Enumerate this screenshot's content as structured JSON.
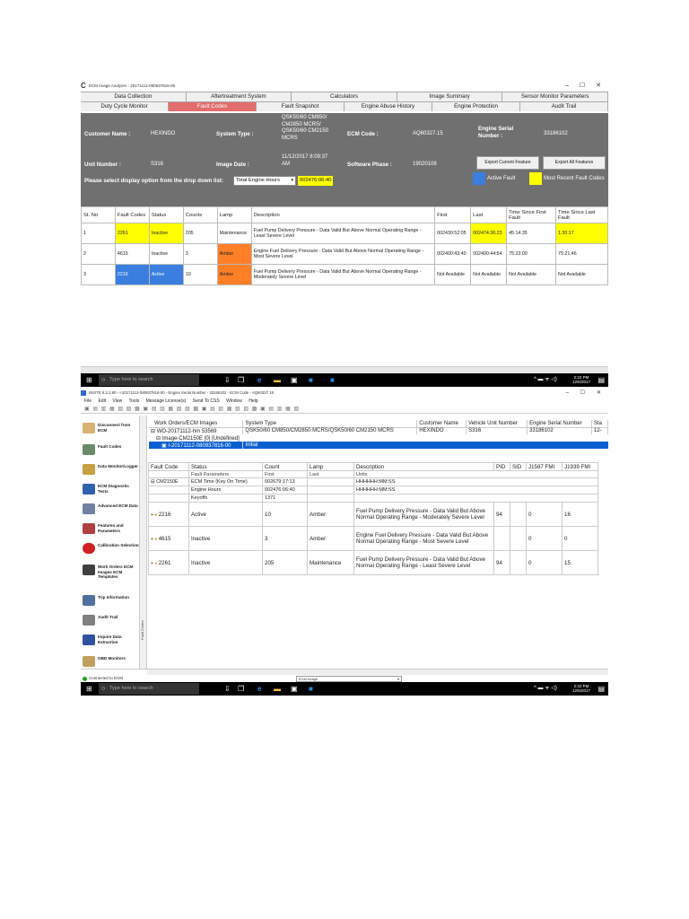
{
  "win1": {
    "title": "ECM Image Analyzer - 20171112-080937816-00",
    "tabs_row1": [
      "Data Collection",
      "Aftertreatment System",
      "Calculators",
      "Image Summary",
      "Sensor Monitor Parameters"
    ],
    "tabs_row2": [
      "Duty Cycle Monitor",
      "Fault Codes",
      "Fault Snapshot",
      "Engine Abuse History",
      "Engine Protection",
      "Audit Trail"
    ],
    "customer_name_label": "Customer Name :",
    "customer_name": "HEXINDO",
    "system_type_label": "System Type :",
    "system_type": "QSK50/60 CM850/ CM2850 MCRS/ QSK50/60 CM2150 MCRS",
    "ecm_code_label": "ECM Code :",
    "ecm_code": "AQ60327.15",
    "engine_serial_label": "Engine Serial Number :",
    "engine_serial": "33186102",
    "unit_number_label": "Unit Number :",
    "unit_number": "S316",
    "image_date_label": "Image Date :",
    "image_date": "11/12/2017 8:09:37 AM",
    "software_phase_label": "Software Phase :",
    "software_phase": "19020108",
    "export_current": "Export Current Feature",
    "export_all": "Export All Features",
    "display_option_label": "Please select display option from the drop down list:",
    "display_option_value": "Total Engine Hours",
    "display_hours": "002476:06:40",
    "legend_active": "Active Fault",
    "legend_recent": "Most Recent Fault Codes",
    "colors": {
      "active": "#3a7fe0",
      "recent": "#ffff00",
      "amber": "#ff7f27",
      "info_bg": "#707070"
    },
    "headers": [
      "St. No",
      "Fault Codes",
      "Status",
      "Counts",
      "Lamp",
      "Description",
      "First",
      "Last",
      "Time Since First Fault",
      "Time Since Last Fault"
    ],
    "rows": [
      [
        "1",
        "2261",
        "Inactive",
        "205",
        "Maintenance",
        "Fuel Pump Delivery Pressure - Data Valid But Above Normal Operating Range - Least Severe Level",
        "002430:52:05",
        "002474:36:23",
        "45:14:35",
        "1:30:17"
      ],
      [
        "2",
        "4615",
        "Inactive",
        "3",
        "Amber",
        "Engine Fuel Delivery Pressure - Data Valid But Above Normal Operating Range - Most Severe Level",
        "002400:43:40",
        "002400:44:54",
        "75:23:00",
        "75:21:46"
      ],
      [
        "3",
        "2216",
        "Active",
        "10",
        "Amber",
        "Fuel Pump Delivery Pressure - Data Valid But Above Normal Operating Range - Moderately Severe Level",
        "Not Available",
        "Not Available",
        "Not Available",
        "Not Available"
      ]
    ]
  },
  "taskbar1": {
    "search": "Type here to search",
    "time": "2:22 PM",
    "date": "12/5/2017"
  },
  "win2": {
    "title": "INSITE 8.2.2.80 - I-20171112-080937816-00 - Engine Serial Number - 33186102 - ECM Code - AQ60327.15",
    "menu": [
      "File",
      "Edit",
      "View",
      "Tools",
      "Message License(s)",
      "Send To CSS",
      "Window",
      "Help"
    ],
    "sidebar": [
      "Disconnect from ECM",
      "Fault Codes",
      "Data Monitor/Logger",
      "ECM Diagnostic Tests",
      "Advanced ECM Data",
      "Features and Parameters",
      "Calibration Selection",
      "Work Orders ECM Images ECM Templates",
      "Trip Information",
      "Audit Trail",
      "Inquire Data Extraction",
      "OBD Monitors"
    ],
    "top_headers": [
      "Work Orders/ECM Images",
      "System Type",
      "Customer Name",
      "Vehicle Unit Number",
      "Engine Serial Number",
      "Sta"
    ],
    "wo_row": [
      "WO-20171112-hm 53569",
      "QSK50/60 CM850/CM2850 MCRS/QSK50/60 CM2150 MCRS",
      "HEXINDO",
      "S316",
      "33186102",
      "12-"
    ],
    "image_row": "Image-CM2150E [0] [Undefined]",
    "selected_row": "I-20171112-080937816-00",
    "selected_status": "Initial",
    "g2_headers": [
      "Fault Code",
      "Status",
      "Count",
      "Lamp",
      "Description",
      "PID",
      "SID",
      "J1587 FMI",
      "J1939 FMI"
    ],
    "g2_sub": [
      "",
      "Fault Parameters",
      "First",
      "Last",
      "Units"
    ],
    "ecm_group": "CM2150E",
    "params": [
      [
        "ECM Time (Key On Time)",
        "002679:17:13",
        "",
        "HHHHHH:MM:SS"
      ],
      [
        "Engine Hours",
        "002476:06:40",
        "",
        "HHHHHH:MM:SS"
      ],
      [
        "Keyoffs",
        "1371",
        "",
        ""
      ]
    ],
    "faults": [
      [
        "2216",
        "Active",
        "10",
        "Amber",
        "Fuel Pump Delivery Pressure - Data Valid But Above Normal Operating Range - Moderately Severe Level",
        "94",
        "",
        "0",
        "16"
      ],
      [
        "4615",
        "Inactive",
        "3",
        "Amber",
        "Engine Fuel Delivery Pressure - Data Valid But Above Normal Operating Range - Most Severe Level",
        "",
        "",
        "0",
        "0"
      ],
      [
        "2261",
        "Inactive",
        "205",
        "Maintenance",
        "Fuel Pump Delivery Pressure - Data Valid But Above Normal Operating Range - Least Severe Level",
        "94",
        "",
        "0",
        "15"
      ]
    ],
    "status_connected": "Connected to ECM",
    "status_dropdown": "ECM Image",
    "vertical_label": "Fault Codes"
  },
  "taskbar2": {
    "search": "Type here to search",
    "time": "2:22 PM",
    "date": "12/5/2017"
  }
}
